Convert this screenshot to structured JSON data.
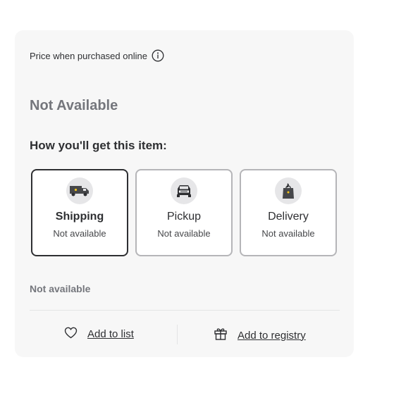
{
  "price": {
    "label": "Price when purchased online",
    "info_icon": "info-circle-icon",
    "value": "Not Available"
  },
  "fulfillment": {
    "title": "How you'll get this item:",
    "options": [
      {
        "label": "Shipping",
        "status": "Not available",
        "icon": "shipping-truck-icon",
        "selected": true
      },
      {
        "label": "Pickup",
        "status": "Not available",
        "icon": "pickup-car-icon",
        "selected": false
      },
      {
        "label": "Delivery",
        "status": "Not available",
        "icon": "delivery-bag-icon",
        "selected": false
      }
    ]
  },
  "availability": {
    "status": "Not available"
  },
  "actions": {
    "add_to_list": {
      "label": "Add to list",
      "icon": "heart-icon"
    },
    "add_to_registry": {
      "label": "Add to registry",
      "icon": "gift-icon"
    }
  },
  "colors": {
    "card_bg": "#f7f7f7",
    "text": "#2e2f32",
    "muted": "#74767c",
    "selected_border": "#2e2f32",
    "border": "#b5b5b8"
  }
}
